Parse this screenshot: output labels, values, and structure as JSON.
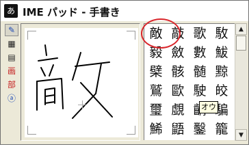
{
  "window": {
    "title": "IME パッド - 手書き",
    "app_icon_glyph": "あ"
  },
  "toolbar": {
    "items": [
      {
        "name": "handwriting-pen-icon",
        "glyph": "✎",
        "color": "#1f4bb5",
        "active": true
      },
      {
        "name": "char-list-icon",
        "glyph": "▦",
        "color": "#222222",
        "active": false
      },
      {
        "name": "soft-keyboard-icon",
        "glyph": "▤",
        "color": "#222222",
        "active": false
      },
      {
        "name": "total-strokes-icon",
        "glyph": "画",
        "color": "#c42020",
        "active": false
      },
      {
        "name": "radical-icon",
        "glyph": "部",
        "color": "#c42020",
        "active": false
      },
      {
        "name": "ime-mode-icon",
        "glyph": "ⓐ",
        "color": "#1f4bb5",
        "active": false
      }
    ]
  },
  "candidates": {
    "rows": [
      [
        "敵",
        "敲",
        "歌",
        "駇"
      ],
      [
        "毅",
        "斂",
        "數",
        "鮁"
      ],
      [
        "檗",
        "骸",
        "髄",
        "黥"
      ],
      [
        "鷲",
        "歐",
        "駛",
        "皎"
      ],
      [
        "璽",
        "覷",
        "齲",
        "騙"
      ],
      [
        "鯑",
        "鼯",
        "鑿",
        "籠"
      ]
    ],
    "highlight_color": "#d9262b"
  },
  "tooltip": {
    "text": "オウ"
  }
}
